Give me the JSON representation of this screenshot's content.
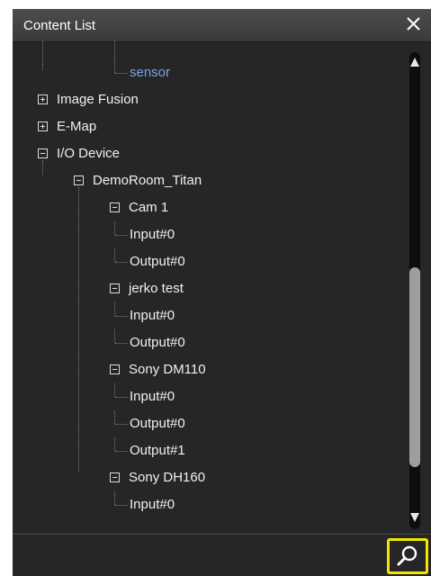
{
  "panel": {
    "title": "Content List"
  },
  "tree": {
    "rows": [
      {
        "label": "sensor",
        "level": 3,
        "expander": "none",
        "selected": true
      },
      {
        "label": "Image Fusion",
        "level": 0,
        "expander": "plus"
      },
      {
        "label": "E-Map",
        "level": 0,
        "expander": "plus"
      },
      {
        "label": "I/O Device",
        "level": 0,
        "expander": "minus"
      },
      {
        "label": "DemoRoom_Titan",
        "level": 1,
        "expander": "minus"
      },
      {
        "label": "Cam 1",
        "level": 2,
        "expander": "minus"
      },
      {
        "label": "Input#0",
        "level": 3,
        "expander": "none"
      },
      {
        "label": "Output#0",
        "level": 3,
        "expander": "none"
      },
      {
        "label": "jerko test",
        "level": 2,
        "expander": "minus"
      },
      {
        "label": "Input#0",
        "level": 3,
        "expander": "none"
      },
      {
        "label": "Output#0",
        "level": 3,
        "expander": "none"
      },
      {
        "label": "Sony DM110",
        "level": 2,
        "expander": "minus"
      },
      {
        "label": "Input#0",
        "level": 3,
        "expander": "none"
      },
      {
        "label": "Output#0",
        "level": 3,
        "expander": "none"
      },
      {
        "label": "Output#1",
        "level": 3,
        "expander": "none"
      },
      {
        "label": "Sony DH160",
        "level": 2,
        "expander": "minus"
      },
      {
        "label": "Input#0",
        "level": 3,
        "expander": "none"
      }
    ]
  },
  "scrollbar": {
    "thumb_start": 0.45,
    "thumb_end": 0.87
  },
  "icons": {
    "close": "close-icon",
    "search": "search-icon",
    "scroll_up": "arrow-up-icon",
    "scroll_down": "arrow-down-icon"
  },
  "colors": {
    "panel_bg": "#262626",
    "titlebar": "#444444",
    "selected_text": "#7ea1de",
    "search_highlight": "#f3e600"
  }
}
